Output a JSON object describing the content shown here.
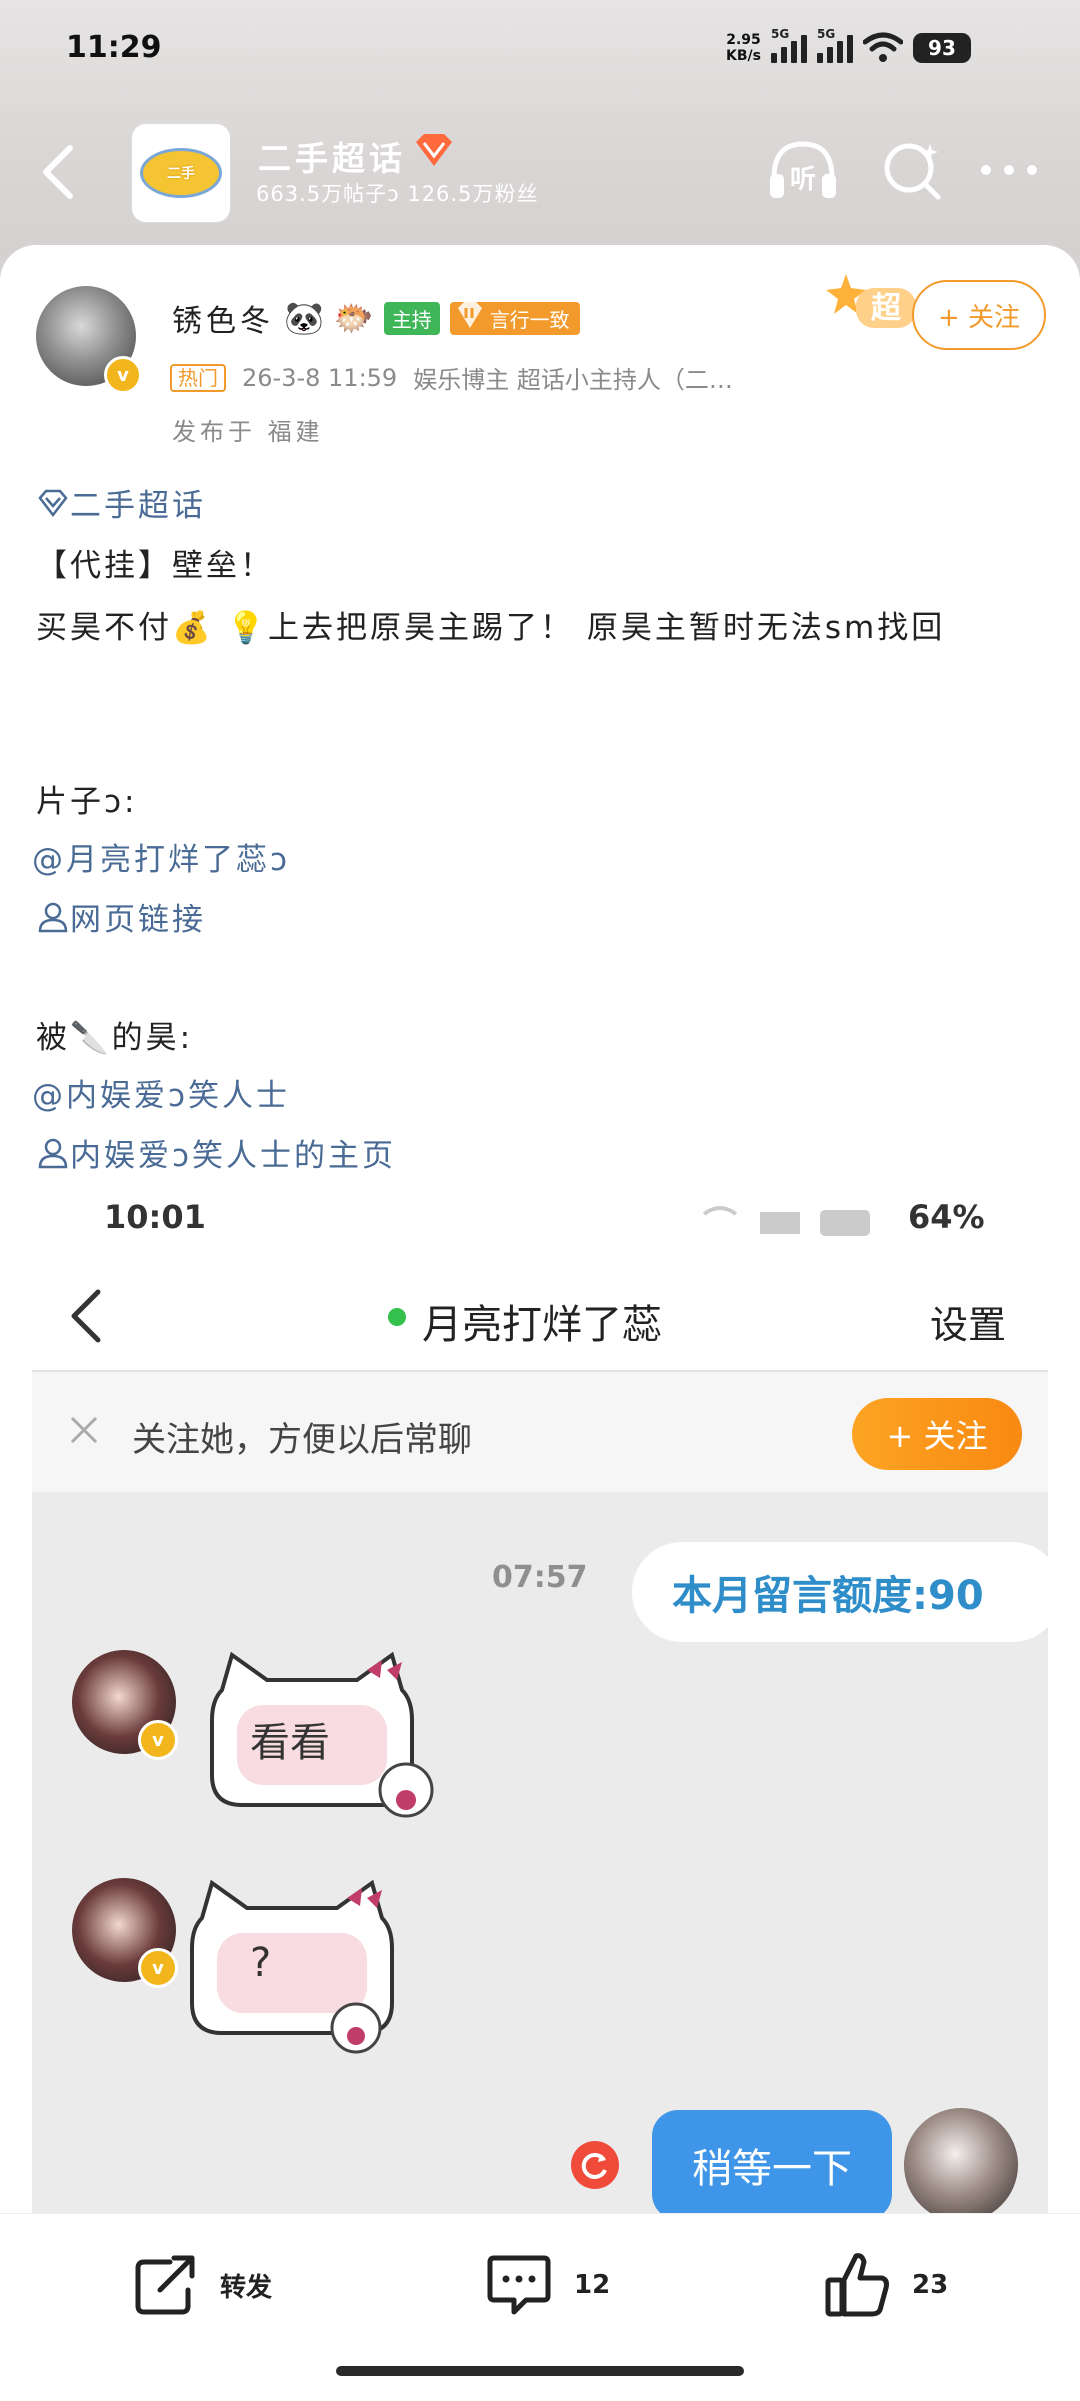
{
  "status_bar": {
    "time": "11:29",
    "net_speed": "2.95",
    "net_unit": "KB/s",
    "signal_label_1": "5G",
    "signal_label_2": "5G",
    "battery": "93"
  },
  "topic_header": {
    "name": "二手超话",
    "stats": "663.5万帖子ↄ 126.5万粉丝",
    "icons": [
      "back-arrow-icon",
      "listen-icon",
      "search-icon",
      "more-icon"
    ],
    "listen_label": "听"
  },
  "post": {
    "author": "锈色冬",
    "author_emojis": [
      "🐼",
      "🐡"
    ],
    "host_tag": "主持",
    "consistency_tag": "言行一致",
    "super_badge": "超",
    "follow_button": "+ 关注",
    "hot_tag": "热门",
    "timestamp": "26-3-8 11:59",
    "roles": "娱乐博主  超话小主持人（二…",
    "location": "发布于 福建",
    "topic_link": "二手超话",
    "body_line1": "【代挂】壁垒！",
    "body_line2": "买昊不付💰 💡上去把原昊主踢了！ 原昊主暂时无法sm找回",
    "body_label_pian": "片子ↄ:",
    "mention_1": "@月亮打烊了蕊ↄ",
    "link_1": "网页链接",
    "body_label_bei": "被🔪的昊:",
    "mention_2": "@内娱爱ↄ笑人士",
    "link_2": "内娱爱ↄ笑人士的主页"
  },
  "embedded_screenshot": {
    "time": "10:01",
    "battery": "64%",
    "chat_title": "月亮打烊了蕊",
    "settings": "设置",
    "follow_prompt": "关注她，方便以后常聊",
    "follow_button": "+ 关注",
    "message_time": "07:57",
    "quota_message": "本月留言额度:90",
    "incoming_1": "看看",
    "incoming_2": "?",
    "outgoing_1": "稍等一下"
  },
  "actions": {
    "repost_label": "转发",
    "comment_count": "12",
    "like_count": "23"
  },
  "colors": {
    "accent_orange": "#f29b2c",
    "link_blue": "#4a6b95",
    "host_green": "#3fb658",
    "chat_blue": "#3f95e8"
  }
}
